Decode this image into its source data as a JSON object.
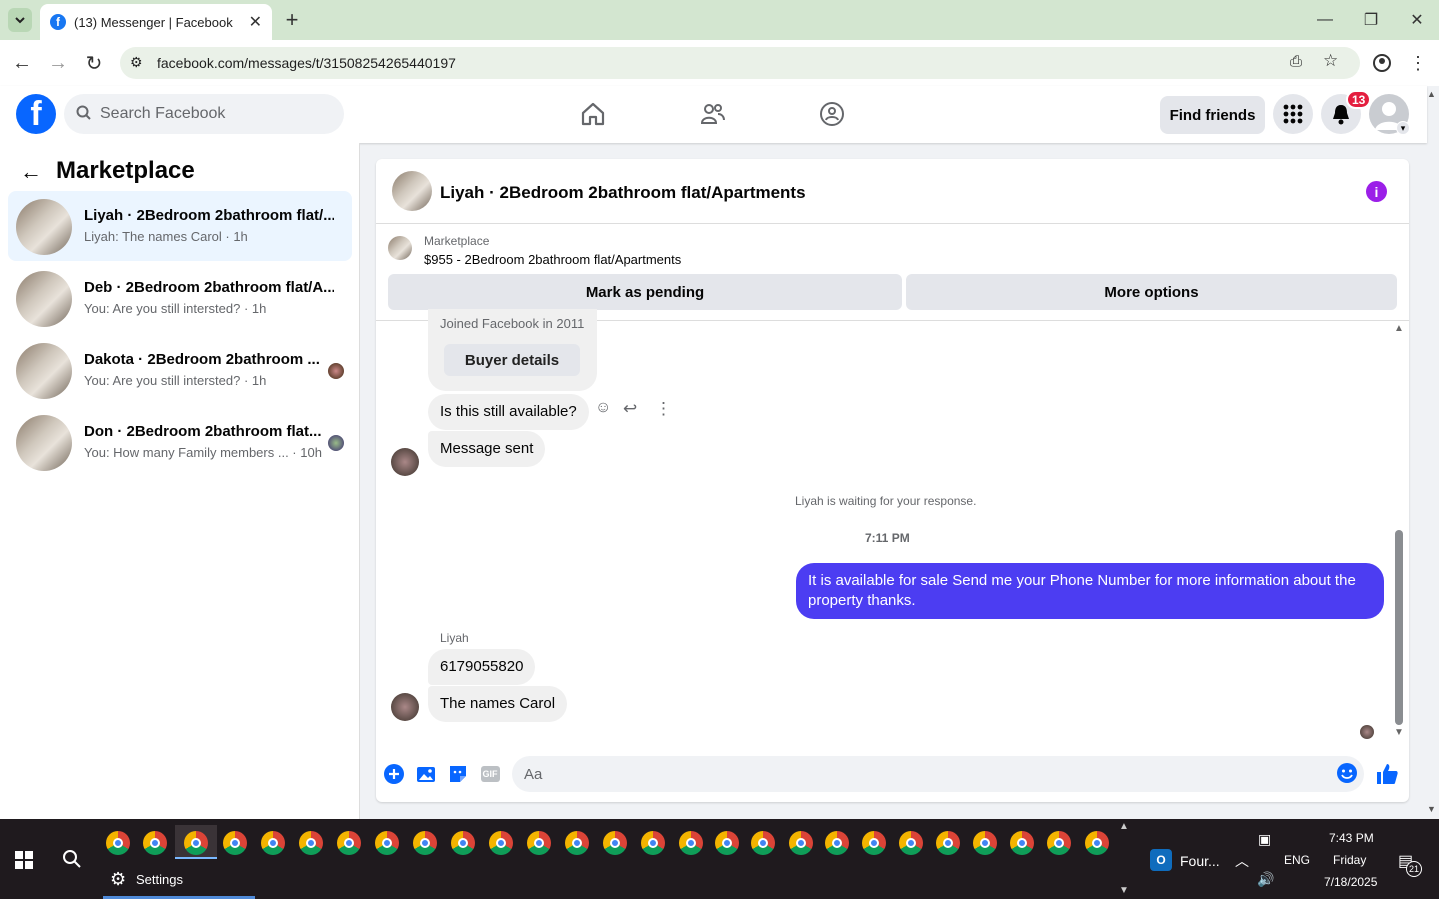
{
  "browser": {
    "tab_title": "(13) Messenger | Facebook",
    "url": "facebook.com/messages/t/31508254265440197"
  },
  "header": {
    "search_placeholder": "Search Facebook",
    "find_friends": "Find friends",
    "notif_count": "13"
  },
  "sidebar": {
    "title": "Marketplace",
    "conversations": [
      {
        "name": "Liyah · 2Bedroom 2bathroom flat/...",
        "preview": "Liyah: The names Carol · 1h",
        "active": true
      },
      {
        "name": "Deb · 2Bedroom 2bathroom flat/A...",
        "preview": "You: Are you still intersted? · 1h",
        "active": false
      },
      {
        "name": "Dakota · 2Bedroom 2bathroom ...",
        "preview": "You: Are you still intersted? · 1h",
        "active": false
      },
      {
        "name": "Don · 2Bedroom 2bathroom flat...",
        "preview": "You: How many Family members ... · 10h",
        "active": false
      }
    ]
  },
  "chat": {
    "title": "Liyah · 2Bedroom 2bathroom flat/Apartments",
    "listing_kind": "Marketplace",
    "listing_title": "$955 - 2Bedroom 2bathroom flat/Apartments",
    "mark_pending": "Mark as pending",
    "more_options": "More options",
    "joined_text": "Joined Facebook in 2011",
    "buyer_details": "Buyer details",
    "msg_available": "Is this still available?",
    "msg_sent": "Message sent",
    "waiting": "Liyah is waiting for your response.",
    "time": "7:11 PM",
    "outgoing": "It is available for sale Send me your Phone Number for more information about the property thanks.",
    "sender": "Liyah",
    "msg_phone": "6179055820",
    "msg_name": "The names Carol",
    "composer_placeholder": "Aa",
    "gif_label": "GIF"
  },
  "taskbar": {
    "settings": "Settings",
    "outlook": "Four...",
    "lang": "ENG",
    "time": "7:43 PM",
    "day": "Friday",
    "date": "7/18/2025",
    "notif": "21"
  }
}
